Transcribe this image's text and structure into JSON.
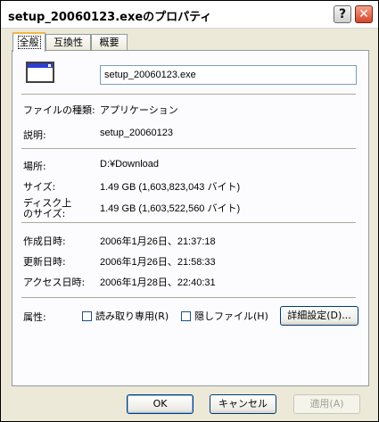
{
  "window": {
    "title": "setup_20060123.exeのプロパティ",
    "help_label": "?",
    "close_label": "✕"
  },
  "tabs": [
    {
      "label": "全般",
      "active": true
    },
    {
      "label": "互換性",
      "active": false
    },
    {
      "label": "概要",
      "active": false
    }
  ],
  "general": {
    "file_name": "setup_20060123.exe",
    "file_type_label": "ファイルの種類:",
    "file_type_value": "アプリケーション",
    "description_label": "説明:",
    "description_value": "setup_20060123",
    "location_label": "場所:",
    "location_value": "D:¥Download",
    "size_label": "サイズ:",
    "size_value": "1.49 GB (1,603,823,043 バイト)",
    "size_on_disk_label_line1": "ディスク上",
    "size_on_disk_label_line2": "のサイズ:",
    "size_on_disk_value": "1.49 GB (1,603,522,560 バイト)",
    "created_label": "作成日時:",
    "created_value": "2006年1月26日、21:37:18",
    "modified_label": "更新日時:",
    "modified_value": "2006年1月26日、21:58:33",
    "accessed_label": "アクセス日時:",
    "accessed_value": "2006年1月28日、22:40:31",
    "attributes_label": "属性:",
    "readonly_label": "読み取り専用(R)",
    "readonly_checked": false,
    "hidden_label": "隠しファイル(H)",
    "hidden_checked": false,
    "advanced_button": "詳細設定(D)..."
  },
  "footer": {
    "ok_label": "OK",
    "cancel_label": "キャンセル",
    "apply_label": "適用(A)"
  },
  "colors": {
    "dialog_bg": "#ece9d8",
    "panel_bg": "#fcfcfe",
    "close_red": "#d4462a",
    "tab_highlight": "#f0b745"
  }
}
